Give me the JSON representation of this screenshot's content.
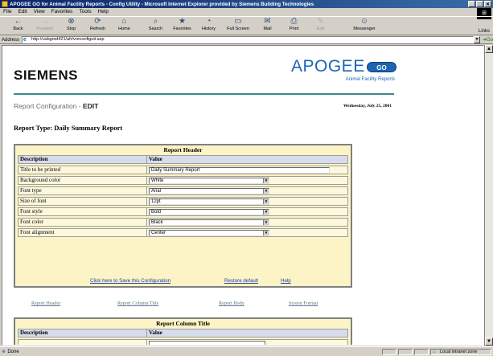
{
  "window": {
    "title": "APOGEE GO for Animal Facility Reports - Config Utility - Microsoft Internet Explorer provided by Siemens Building Technologies",
    "controls": [
      "_",
      "□",
      "✕"
    ]
  },
  "menu": [
    "File",
    "Edit",
    "View",
    "Favorites",
    "Tools",
    "Help"
  ],
  "toolbar": [
    {
      "label": "Back",
      "icon": "←"
    },
    {
      "label": "Forward",
      "icon": "→"
    },
    {
      "label": "Stop",
      "icon": "⊗"
    },
    {
      "label": "Refresh",
      "icon": "⟳"
    },
    {
      "label": "Home",
      "icon": "⌂"
    },
    {
      "label": "Search",
      "icon": "⌕"
    },
    {
      "label": "Favorites",
      "icon": "★"
    },
    {
      "label": "History",
      "icon": "◔"
    },
    {
      "label": "Full Screen",
      "icon": "▭"
    },
    {
      "label": "Mail",
      "icon": "✉"
    },
    {
      "label": "Print",
      "icon": "⎙"
    },
    {
      "label": "Edit",
      "icon": "✎"
    },
    {
      "label": "Messenger",
      "icon": "☺"
    }
  ],
  "links_label": "Links",
  "address": {
    "label": "Address",
    "url": "http://usbgmd421/afr/vreconfiguti.asp",
    "go_label": "Go"
  },
  "page": {
    "brand": "SIEMENS",
    "product": "APOGEE",
    "badge": "GO",
    "subtitle": "Animal Facility Reports",
    "section": "Report Configuration - ",
    "mode": "EDIT",
    "date": "Wednesday, July 25, 2001",
    "report_type": "Report Type: Daily Summary Report"
  },
  "report_header": {
    "title": "Report Header",
    "col_desc": "Description",
    "col_value": "Value",
    "rows": [
      {
        "label": "Title to be printed",
        "value": "Daily Summary Report",
        "kind": "text"
      },
      {
        "label": "Background color",
        "value": "White",
        "kind": "select"
      },
      {
        "label": "Font type",
        "value": "Arial",
        "kind": "select"
      },
      {
        "label": "Size of font",
        "value": "12pt",
        "kind": "select"
      },
      {
        "label": "Font style",
        "value": "Bold",
        "kind": "select"
      },
      {
        "label": "Font color",
        "value": "Black",
        "kind": "select"
      },
      {
        "label": "Font alignment",
        "value": "Center",
        "kind": "select"
      }
    ],
    "actions": {
      "save": "Click here to Save this Configuration",
      "restore": "Restore default",
      "help": "Help"
    }
  },
  "nav_tabs": [
    "Report Header",
    "Report Column Title",
    "Report Body",
    "Screen Format"
  ],
  "report_column_title": {
    "title": "Report Column Title",
    "col_desc": "Description",
    "col_value": "Value"
  },
  "status": {
    "text": "Done",
    "zone": "Local intranet zone"
  }
}
